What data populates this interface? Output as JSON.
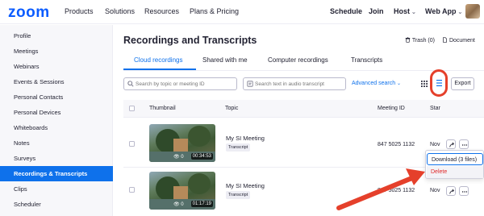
{
  "header": {
    "logo": "zoom",
    "nav": [
      "Products",
      "Solutions",
      "Resources",
      "Plans & Pricing"
    ],
    "right": {
      "schedule": "Schedule",
      "join": "Join",
      "host": "Host",
      "webapp": "Web App"
    }
  },
  "sidebar": {
    "items": [
      {
        "label": "Profile"
      },
      {
        "label": "Meetings"
      },
      {
        "label": "Webinars"
      },
      {
        "label": "Events & Sessions"
      },
      {
        "label": "Personal Contacts"
      },
      {
        "label": "Personal Devices"
      },
      {
        "label": "Whiteboards"
      },
      {
        "label": "Notes"
      },
      {
        "label": "Surveys"
      },
      {
        "label": "Recordings & Transcripts"
      },
      {
        "label": "Clips"
      },
      {
        "label": "Scheduler"
      }
    ],
    "active_index": 9
  },
  "main": {
    "title": "Recordings and Transcripts",
    "trash": "Trash (0)",
    "document": "Document",
    "tabs": [
      {
        "label": "Cloud recordings"
      },
      {
        "label": "Shared with me"
      },
      {
        "label": "Computer recordings"
      },
      {
        "label": "Transcripts"
      }
    ],
    "search_topic_placeholder": "Search by topic or meeting ID",
    "search_transcript_placeholder": "Search text in audio transcript",
    "advanced_search": "Advanced search",
    "export": "Export"
  },
  "table": {
    "headers": {
      "thumbnail": "Thumbnail",
      "topic": "Topic",
      "meeting_id": "Meeting ID",
      "start": "Star"
    },
    "rows": [
      {
        "topic": "My SI Meeting",
        "badge": "Transcript",
        "views": "0",
        "duration": "00:34:53",
        "meeting_id": "847 5025 1132",
        "start": "Nov"
      },
      {
        "topic": "My SI Meeting",
        "badge": "Transcript",
        "views": "0",
        "duration": "01:17:19",
        "meeting_id": "847 5025 1132",
        "start": "Nov"
      }
    ]
  },
  "dropdown": {
    "download": "Download (3 files)",
    "delete": "Delete"
  },
  "colors": {
    "brand": "#0b5cff",
    "accent": "#0e71eb",
    "annotation_red": "#e5402b",
    "danger": "#e02828"
  }
}
